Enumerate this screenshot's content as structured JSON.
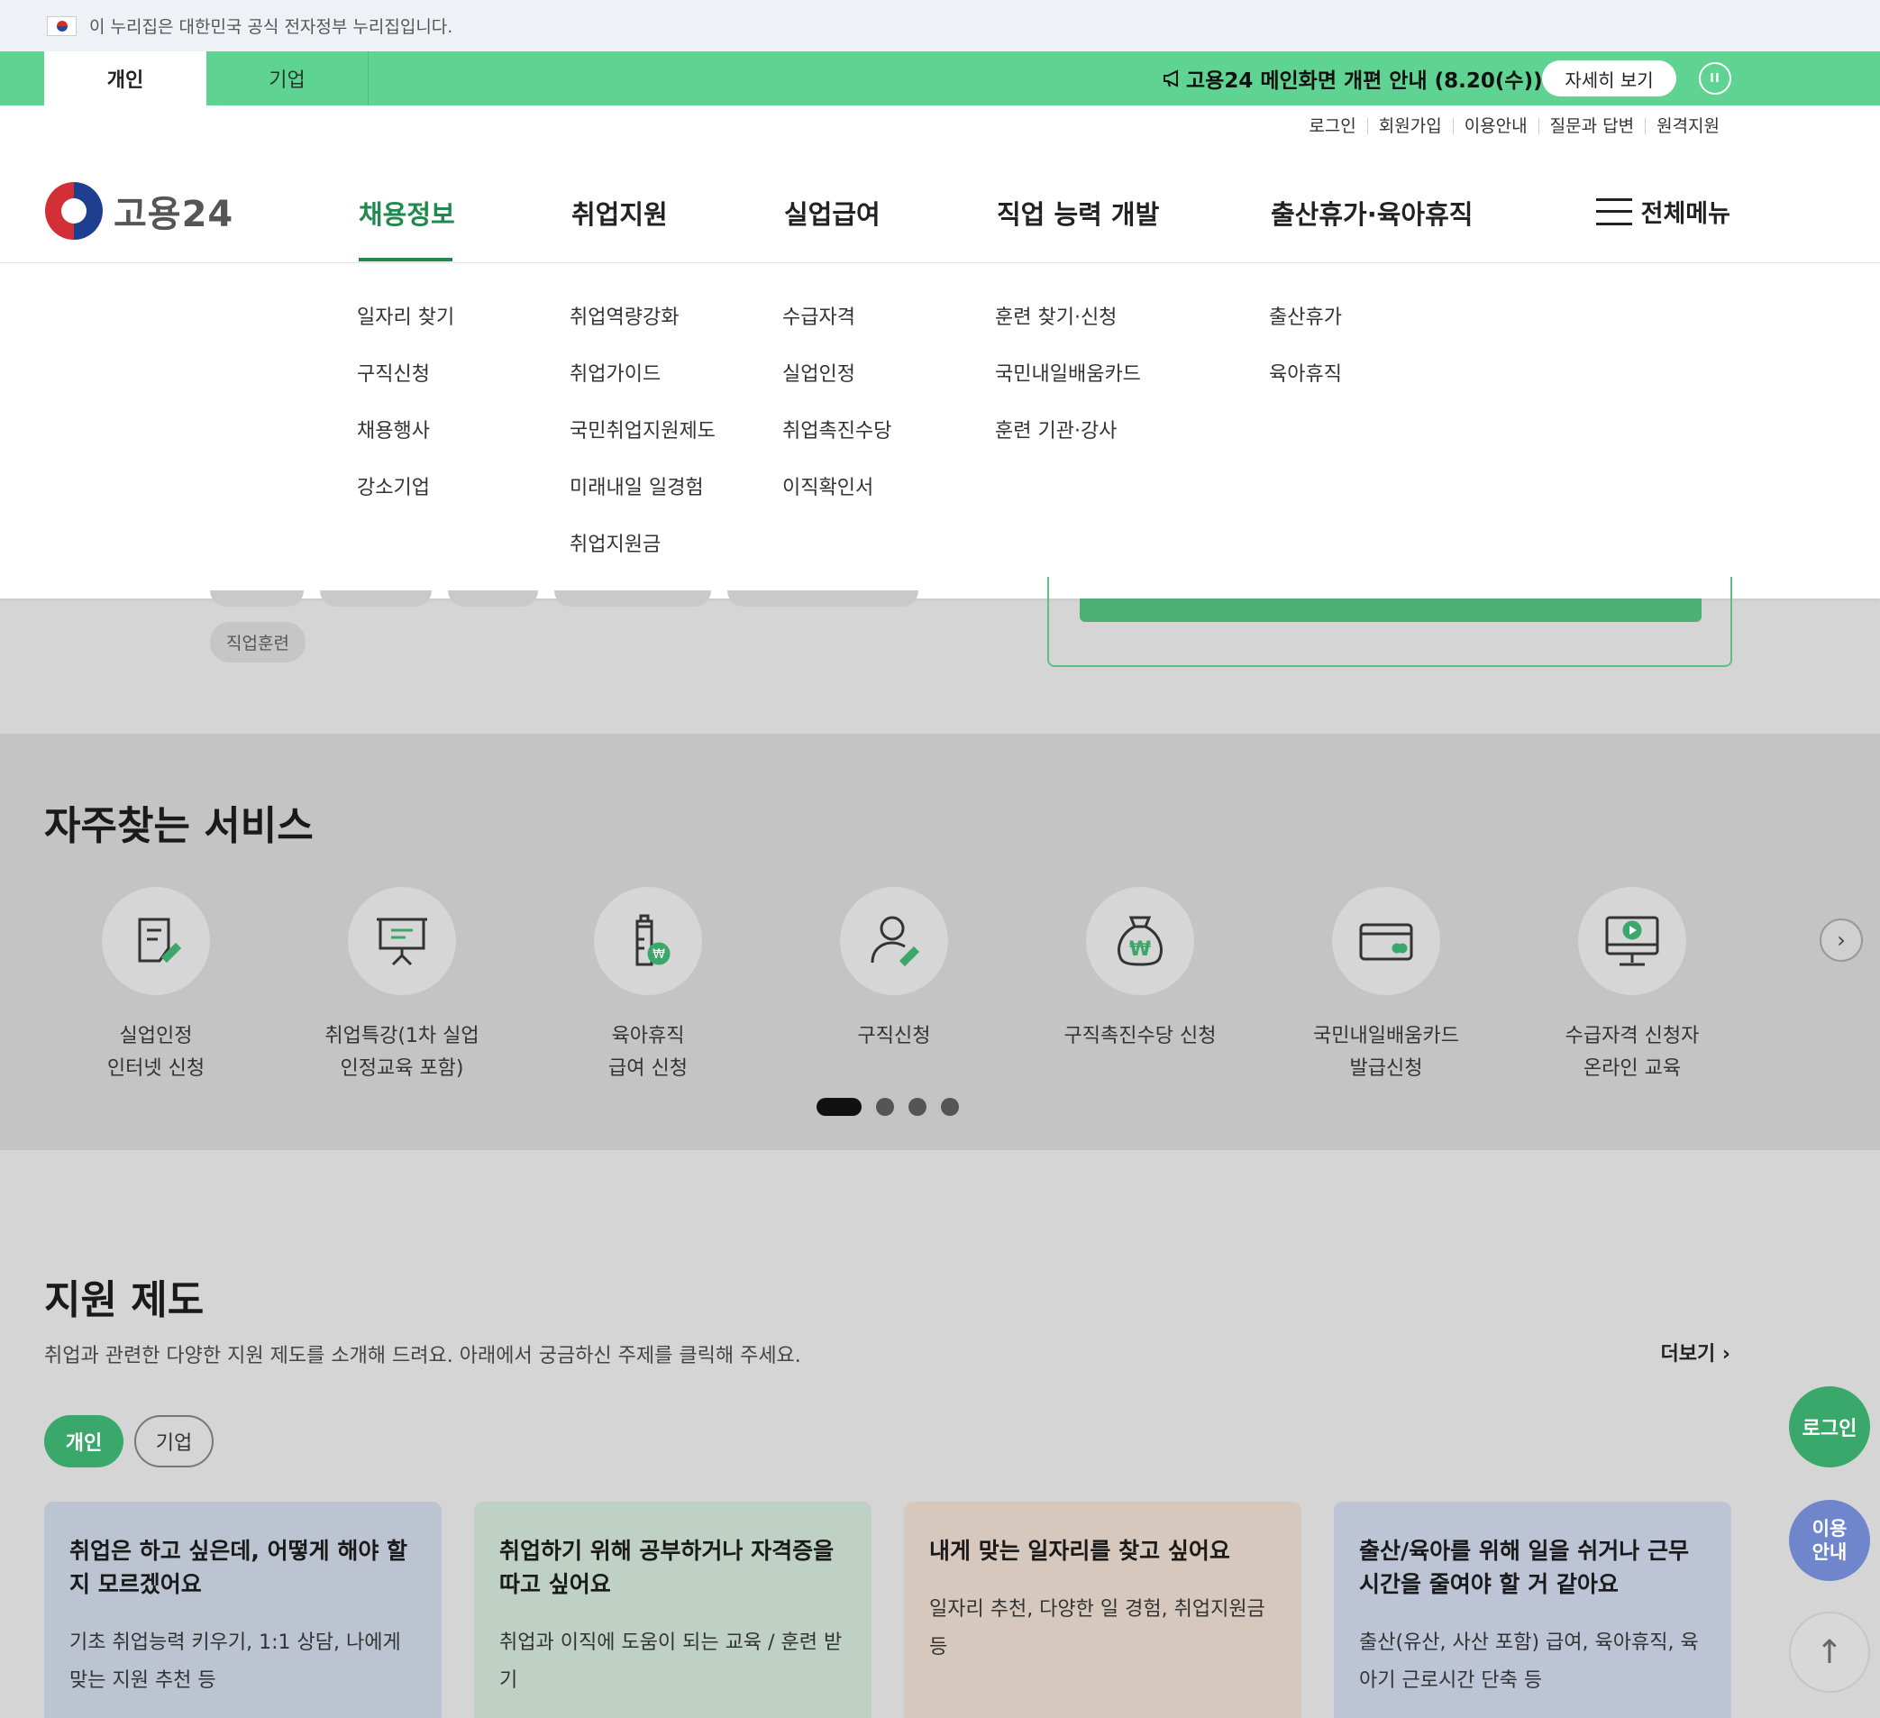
{
  "gov_banner": {
    "text": "이 누리집은 대한민국 공식 전자정부 누리집입니다."
  },
  "notice_bar": {
    "tabs": [
      "개인",
      "기업"
    ],
    "notice": "고용24 메인화면 개편 안내 (8.20(수))",
    "detail_button": "자세히 보기",
    "pause_label": "II"
  },
  "header": {
    "util_links": [
      "로그인",
      "회원가입",
      "이용안내",
      "질문과 답변",
      "원격지원"
    ],
    "logo_text": "고용24",
    "gnb": [
      "채용정보",
      "취업지원",
      "실업급여",
      "직업 능력 개발",
      "출산휴가·육아휴직"
    ],
    "all_menu": "전체메뉴"
  },
  "dropdown": {
    "col1": [
      "일자리 찾기",
      "구직신청",
      "채용행사",
      "강소기업"
    ],
    "col2": [
      "취업역량강화",
      "취업가이드",
      "국민취업지원제도",
      "미래내일 일경험",
      "취업지원금"
    ],
    "col3": [
      "수급자격",
      "실업인정",
      "취업촉진수당",
      "이직확인서"
    ],
    "col4": [
      "훈련 찾기·신청",
      "국민내일배움카드",
      "훈련 기관·강사"
    ],
    "col5": [
      "출산휴가",
      "육아휴직"
    ]
  },
  "chip": "직업훈련",
  "services": {
    "title": "자주찾는 서비스",
    "items": [
      {
        "line1": "실업인정",
        "line2": "인터넷 신청",
        "icon": "document-pen-icon"
      },
      {
        "line1": "취업특강(1차 실업",
        "line2": "인정교육 포함)",
        "icon": "presentation-board-icon"
      },
      {
        "line1": "육아휴직",
        "line2": "급여 신청",
        "icon": "baby-bottle-won-icon"
      },
      {
        "line1": "구직신청",
        "line2": "",
        "icon": "person-pen-icon"
      },
      {
        "line1": "구직촉진수당 신청",
        "line2": "",
        "icon": "money-bag-icon"
      },
      {
        "line1": "국민내일배움카드",
        "line2": "발급신청",
        "icon": "card-icon"
      },
      {
        "line1": "수급자격 신청자",
        "line2": "온라인 교육",
        "icon": "monitor-play-icon"
      }
    ]
  },
  "support": {
    "title": "지원 제도",
    "desc": "취업과 관련한 다양한 지원 제도를 소개해 드려요. 아래에서 궁금하신 주제를 클릭해 주세요.",
    "more": "더보기",
    "segments": [
      "개인",
      "기업"
    ],
    "cards": [
      {
        "title_1": "취업은 하고 싶은데, 어떻게 해야 할",
        "title_2": "지 모르겠어요",
        "desc_1": "기초 취업능력 키우기, 1:1 상담, 나에게",
        "desc_2": "맞는 지원 추천 등",
        "color": "#bcc4d2"
      },
      {
        "title_1": "취업하기 위해 공부하거나 자격증을",
        "title_2": "따고 싶어요",
        "desc_1": "취업과 이직에 도움이 되는 교육 / 훈련 받",
        "desc_2": "기",
        "color": "#bfd0c5"
      },
      {
        "title_1": "내게 맞는 일자리를 찾고 싶어요",
        "title_2": "",
        "desc_1": "일자리 추천, 다양한 일 경험, 취업지원금",
        "desc_2": "등",
        "color": "#d6c8bd"
      },
      {
        "title_1": "출산/육아를 위해 일을 쉬거나 근무",
        "title_2": "시간을 줄여야 할 거 같아요",
        "desc_1": "출산(유산, 사산 포함) 급여, 육아휴직, 육",
        "desc_2": "아기 근로시간 단축 등",
        "color": "#bcc4d6"
      }
    ]
  },
  "floating": {
    "login": "로그인",
    "guide_1": "이용",
    "guide_2": "안내",
    "top": "↑"
  },
  "colors": {
    "brand_green": "#5fd391",
    "active_green": "#1f8a4c",
    "button_green": "#3aa86a",
    "guide_blue": "#6f86cc"
  }
}
